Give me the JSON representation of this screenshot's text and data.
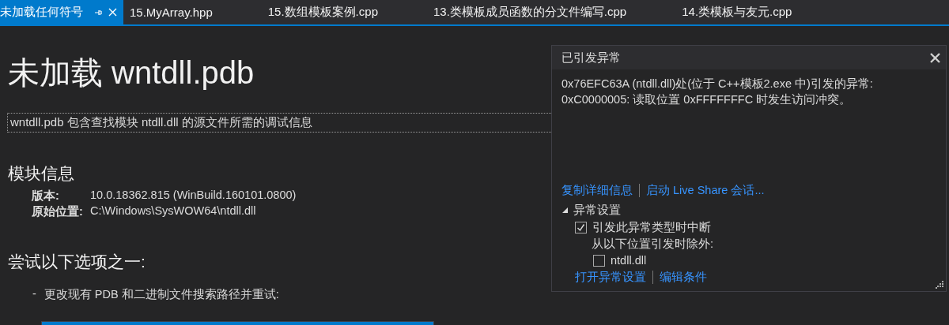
{
  "tabs": [
    {
      "label": "未加载任何符号",
      "selected": true
    },
    {
      "label": "15.MyArray.hpp",
      "selected": false
    },
    {
      "label": "15.数组模板案例.cpp",
      "selected": false
    },
    {
      "label": "13.类模板成员函数的分文件编写.cpp",
      "selected": false
    },
    {
      "label": "14.类模板与友元.cpp",
      "selected": false
    }
  ],
  "page": {
    "title": "未加载 wntdll.pdb",
    "description": "wntdll.pdb 包含查找模块 ntdll.dll 的源文件所需的调试信息",
    "module_heading": "模块信息",
    "module_info": [
      {
        "label": "版本:",
        "value": "10.0.18362.815 (WinBuild.160101.0800)"
      },
      {
        "label": "原始位置:",
        "value": "C:\\Windows\\SysWOW64\\ntdll.dll"
      }
    ],
    "options_heading": "尝试以下选项之一:",
    "options": [
      {
        "bullet": "-",
        "text": "更改现有 PDB 和二进制文件搜索路径并重试:"
      }
    ]
  },
  "exception_popup": {
    "title": "已引发异常",
    "message": [
      "0x76EFC63A (ntdll.dll)处(位于 C++模板2.exe 中)引发的异常:",
      "0xC0000005: 读取位置 0xFFFFFFFC 时发生访问冲突。"
    ],
    "links": [
      "复制详细信息",
      "启动 Live Share 会话..."
    ],
    "settings": {
      "label": "异常设置",
      "expanded": true,
      "break_checkbox": {
        "label": "引发此异常类型时中断",
        "checked": true
      },
      "except_label": "从以下位置引发时除外:",
      "modules": [
        {
          "label": "ntdll.dll",
          "checked": false
        }
      ]
    },
    "bottom_links": [
      "打开异常设置",
      "编辑条件"
    ]
  }
}
